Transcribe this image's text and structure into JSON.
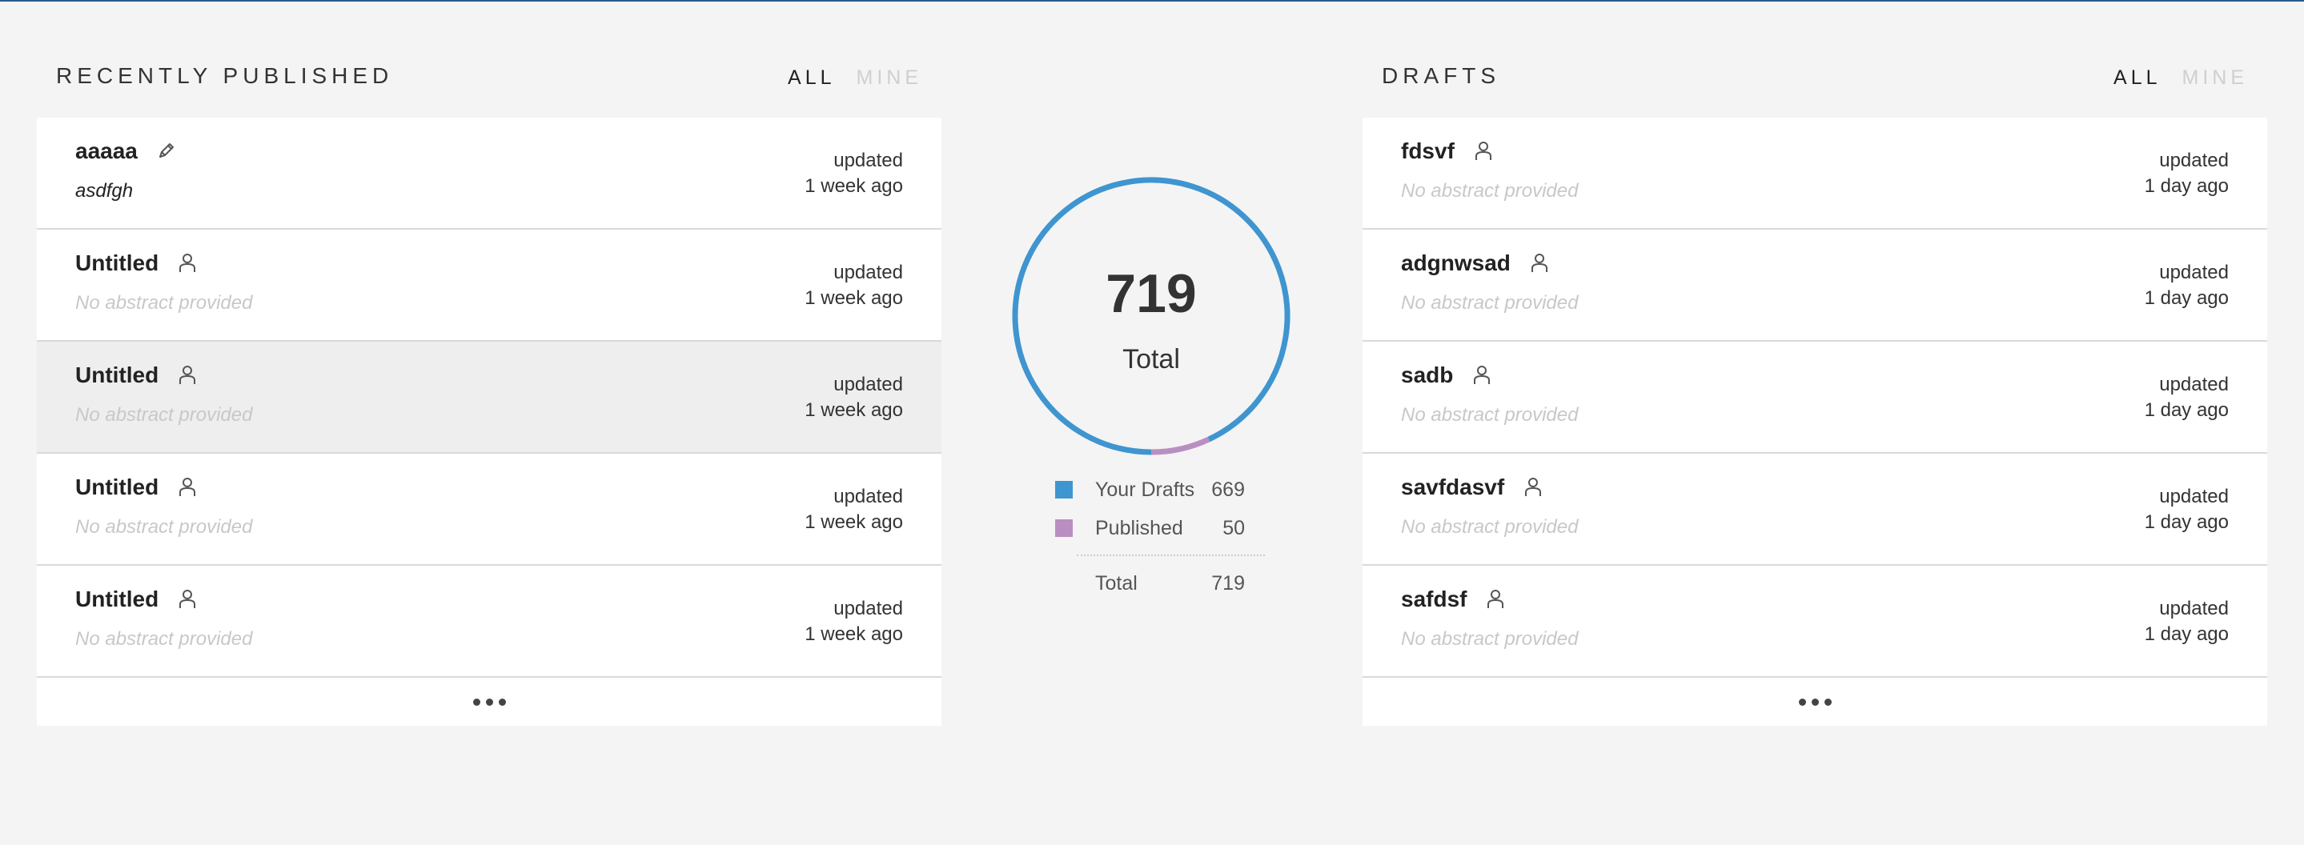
{
  "recently_published": {
    "title": "RECENTLY PUBLISHED",
    "filter_all": "ALL",
    "filter_mine": "MINE",
    "items": [
      {
        "title": "aaaaa",
        "icon": "pencil-icon",
        "abstract": "asdfgh",
        "updated_label": "updated",
        "updated_time": "1 week ago"
      },
      {
        "title": "Untitled",
        "icon": "person-icon",
        "abstract": "No abstract provided",
        "updated_label": "updated",
        "updated_time": "1 week ago"
      },
      {
        "title": "Untitled",
        "icon": "person-icon",
        "abstract": "No abstract provided",
        "updated_label": "updated",
        "updated_time": "1 week ago"
      },
      {
        "title": "Untitled",
        "icon": "person-icon",
        "abstract": "No abstract provided",
        "updated_label": "updated",
        "updated_time": "1 week ago"
      },
      {
        "title": "Untitled",
        "icon": "person-icon",
        "abstract": "No abstract provided",
        "updated_label": "updated",
        "updated_time": "1 week ago"
      }
    ],
    "more_icon": "ellipsis-icon"
  },
  "drafts": {
    "title": "DRAFTS",
    "filter_all": "ALL",
    "filter_mine": "MINE",
    "items": [
      {
        "title": "fdsvf",
        "icon": "person-icon",
        "abstract": "No abstract provided",
        "updated_label": "updated",
        "updated_time": "1 day ago"
      },
      {
        "title": "adgnwsad",
        "icon": "person-icon",
        "abstract": "No abstract provided",
        "updated_label": "updated",
        "updated_time": "1 day ago"
      },
      {
        "title": "sadb",
        "icon": "person-icon",
        "abstract": "No abstract provided",
        "updated_label": "updated",
        "updated_time": "1 day ago"
      },
      {
        "title": "savfdasvf",
        "icon": "person-icon",
        "abstract": "No abstract provided",
        "updated_label": "updated",
        "updated_time": "1 day ago"
      },
      {
        "title": "safdsf",
        "icon": "person-icon",
        "abstract": "No abstract provided",
        "updated_label": "updated",
        "updated_time": "1 day ago"
      }
    ],
    "more_icon": "ellipsis-icon"
  },
  "summary": {
    "total_number": "719",
    "total_label": "Total",
    "legend": [
      {
        "name": "Your Drafts",
        "value": "669",
        "color": "#3f95cf"
      },
      {
        "name": "Published",
        "value": "50",
        "color": "#b98fc2"
      }
    ],
    "legend_total_label": "Total",
    "legend_total_value": "719"
  },
  "chart_data": {
    "type": "pie",
    "categories": [
      "Your Drafts",
      "Published"
    ],
    "values": [
      669,
      50
    ],
    "colors": [
      "#3f95cf",
      "#b98fc2"
    ],
    "total": 719
  },
  "colors": {
    "accent": "#3f95cf",
    "published": "#b98fc2",
    "top_rule": "#2b5a8a",
    "background": "#f4f4f4"
  }
}
